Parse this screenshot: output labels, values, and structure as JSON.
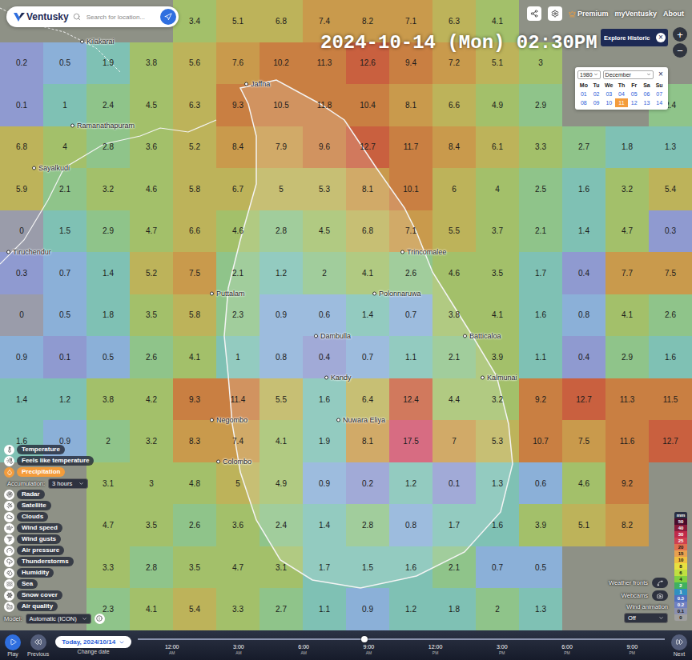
{
  "header": {
    "logo": "Ventusky",
    "search_placeholder": "Search for location...",
    "datetime": "2024-10-14 (Mon) 02:30PM",
    "links": [
      "Premium",
      "myVentusky",
      "About"
    ],
    "zoom": [
      "+",
      "−"
    ]
  },
  "popup": {
    "title": "Explore Historic",
    "close": "×"
  },
  "calendar": {
    "close": "×",
    "year": "1980",
    "month": "December",
    "weekdays": [
      "Mo",
      "Tu",
      "We",
      "Th",
      "Fr",
      "Sa",
      "Su"
    ],
    "days": [
      {
        "label": "01",
        "selected": false
      },
      {
        "label": "02",
        "selected": false
      },
      {
        "label": "03",
        "selected": false
      },
      {
        "label": "04",
        "selected": false
      },
      {
        "label": "05",
        "selected": false
      },
      {
        "label": "06",
        "selected": false
      },
      {
        "label": "07",
        "selected": false
      },
      {
        "label": "08",
        "selected": false
      },
      {
        "label": "09",
        "selected": false
      },
      {
        "label": "10",
        "selected": false
      },
      {
        "label": "11",
        "selected": true
      },
      {
        "label": "12",
        "selected": false
      },
      {
        "label": "13",
        "selected": false
      },
      {
        "label": "14",
        "selected": false
      }
    ]
  },
  "precipitation_grid": [
    [
      null,
      null,
      null,
      null,
      "3.4",
      "5.1",
      "6.8",
      "7.4",
      "8.2",
      "7.1",
      "6.3",
      "4.1",
      null,
      null,
      null,
      null
    ],
    [
      "0.2",
      "0.5",
      "1.9",
      "3.8",
      "5.6",
      "7.6",
      "10.2",
      "11.3",
      "12.6",
      "9.4",
      "7.2",
      "5.1",
      "3",
      null,
      null,
      null
    ],
    [
      "0.1",
      "1",
      "2.4",
      "4.5",
      "6.3",
      "9.3",
      "10.5",
      "11.8",
      "10.4",
      "8.1",
      "6.6",
      "4.9",
      "2.9",
      null,
      null,
      "2.4"
    ],
    [
      "6.8",
      "4",
      "2.8",
      "3.6",
      "5.2",
      "8.4",
      "7.9",
      "9.6",
      "12.7",
      "11.7",
      "8.4",
      "6.1",
      "3.3",
      "2.7",
      "1.8",
      "1.3"
    ],
    [
      "5.9",
      "2.1",
      "3.2",
      "4.6",
      "5.8",
      "6.7",
      "5",
      "5.3",
      "8.1",
      "10.1",
      "6",
      "4",
      "2.5",
      "1.6",
      "3.2",
      "5.4"
    ],
    [
      "0",
      "1.5",
      "2.9",
      "4.7",
      "6.6",
      "4.6",
      "2.8",
      "4.5",
      "6.8",
      "7.1",
      "5.5",
      "3.7",
      "2.1",
      "1.4",
      "4.7",
      "0.3"
    ],
    [
      "0.3",
      "0.7",
      "1.4",
      "5.2",
      "7.5",
      "2.1",
      "1.2",
      "2",
      "4.1",
      "2.6",
      "4.6",
      "3.5",
      "1.7",
      "0.4",
      "7.7",
      "7.5"
    ],
    [
      "0",
      "0.5",
      "1.8",
      "3.5",
      "5.8",
      "2.3",
      "0.9",
      "0.6",
      "1.4",
      "0.7",
      "3.8",
      "4.1",
      "1.6",
      "0.8",
      "4.1",
      "2.6"
    ],
    [
      "0.9",
      "0.1",
      "0.5",
      "2.6",
      "4.1",
      "1",
      "0.8",
      "0.4",
      "0.7",
      "1.1",
      "2.1",
      "3.9",
      "1.1",
      "0.4",
      "2.9",
      "1.6"
    ],
    [
      "1.4",
      "1.2",
      "3.8",
      "4.2",
      "9.3",
      "11.4",
      "5.5",
      "1.6",
      "6.4",
      "12.4",
      "4.4",
      "3.2",
      "9.2",
      "12.7",
      "11.3",
      "11.5"
    ],
    [
      "1.6",
      "0.9",
      "2",
      "3.2",
      "8.3",
      "7.4",
      "4.1",
      "1.9",
      "8.1",
      "17.5",
      "7",
      "5.3",
      "10.7",
      "7.5",
      "11.6",
      "12.7"
    ],
    [
      null,
      null,
      "3.1",
      "3",
      "4.8",
      "5",
      "4.9",
      "0.9",
      "0.2",
      "1.2",
      "0.1",
      "1.3",
      "0.6",
      "4.6",
      "9.2",
      null
    ],
    [
      null,
      null,
      "4.7",
      "3.5",
      "2.6",
      "3.6",
      "2.4",
      "1.4",
      "2.8",
      "0.8",
      "1.7",
      "1.6",
      "3.9",
      "5.1",
      "8.2",
      null
    ],
    [
      null,
      null,
      "3.3",
      "2.8",
      "3.5",
      "4.7",
      "3.1",
      "1.7",
      "1.5",
      "1.6",
      "2.1",
      "0.7",
      "0.5",
      null,
      null,
      null
    ],
    [
      null,
      null,
      "2.3",
      "4.1",
      "5.4",
      "3.3",
      "2.7",
      "1.1",
      "0.9",
      "1.2",
      "1.8",
      "2",
      "1.3",
      null,
      null,
      null
    ]
  ],
  "cities": [
    "Kilakarai",
    "Ramanathapuram",
    "Sayalkudi",
    "Tiruchendur",
    "Jaffna",
    "Trincomalee",
    "Puttalam",
    "Polonnaruwa",
    "Dambulla",
    "Batticaloa",
    "Kandy",
    "Kalmunai",
    "Negombo",
    "Nuwara Eliya",
    "Colombo"
  ],
  "layers": [
    {
      "kind": "layer",
      "label": "Temperature",
      "selected": false
    },
    {
      "kind": "layer",
      "label": "Feels like temperature",
      "selected": false
    },
    {
      "kind": "layer",
      "label": "Precipitation",
      "selected": true
    },
    {
      "kind": "accumulation",
      "label": "Accumulation:",
      "value": "3 hours"
    },
    {
      "kind": "layer",
      "label": "Radar",
      "selected": false
    },
    {
      "kind": "layer",
      "label": "Satellite",
      "selected": false
    },
    {
      "kind": "layer",
      "label": "Clouds",
      "selected": false
    },
    {
      "kind": "layer",
      "label": "Wind speed",
      "selected": false
    },
    {
      "kind": "layer",
      "label": "Wind gusts",
      "selected": false
    },
    {
      "kind": "layer",
      "label": "Air pressure",
      "selected": false
    },
    {
      "kind": "layer",
      "label": "Thunderstorms",
      "selected": false
    },
    {
      "kind": "layer",
      "label": "Humidity",
      "selected": false
    },
    {
      "kind": "layer",
      "label": "Sea",
      "selected": false
    },
    {
      "kind": "layer",
      "label": "Snow cover",
      "selected": false
    },
    {
      "kind": "layer",
      "label": "Air quality",
      "selected": false
    }
  ],
  "model": {
    "label": "Model:",
    "value": "Automatic (ICON)"
  },
  "legend": {
    "unit": "mm",
    "steps": [
      {
        "label": "50",
        "color": "#4a0c2c"
      },
      {
        "label": "40",
        "color": "#8a1a3a"
      },
      {
        "label": "30",
        "color": "#c02a4a"
      },
      {
        "label": "25",
        "color": "#d04050"
      },
      {
        "label": "20",
        "color": "#e07050"
      },
      {
        "label": "15",
        "color": "#e8a050"
      },
      {
        "label": "10",
        "color": "#f0c040"
      },
      {
        "label": "8",
        "color": "#e8e040"
      },
      {
        "label": "6",
        "color": "#c0e040"
      },
      {
        "label": "4",
        "color": "#80d040"
      },
      {
        "label": "2",
        "color": "#40b060"
      },
      {
        "label": "1",
        "color": "#3090c0"
      },
      {
        "label": "0.5",
        "color": "#5070c0"
      },
      {
        "label": "0.2",
        "color": "#7080c0"
      },
      {
        "label": "0.1",
        "color": "#8a90b0"
      },
      {
        "label": "0",
        "color": "#a0a0a0"
      }
    ]
  },
  "map_controls": {
    "weather_fronts": {
      "label": "Weather fronts",
      "on": false
    },
    "webcams": {
      "label": "Webcams",
      "on": false
    },
    "wind_animation": {
      "label": "Wind animation",
      "value": "Off"
    }
  },
  "playback": {
    "play": "Play",
    "previous": "Previous",
    "next": "Next",
    "date": "Today, 2024/10/14",
    "change_date": "Change date",
    "level": 0.43,
    "ticks": [
      {
        "time": "12:00",
        "ampm": "AM"
      },
      {
        "time": "3:00",
        "ampm": "AM"
      },
      {
        "time": "6:00",
        "ampm": "AM"
      },
      {
        "time": "9:00",
        "ampm": "AM"
      },
      {
        "time": "12:00",
        "ampm": "PM"
      },
      {
        "time": "3:00",
        "ampm": "PM"
      },
      {
        "time": "6:00",
        "ampm": "PM"
      },
      {
        "time": "9:00",
        "ampm": "PM"
      }
    ]
  }
}
